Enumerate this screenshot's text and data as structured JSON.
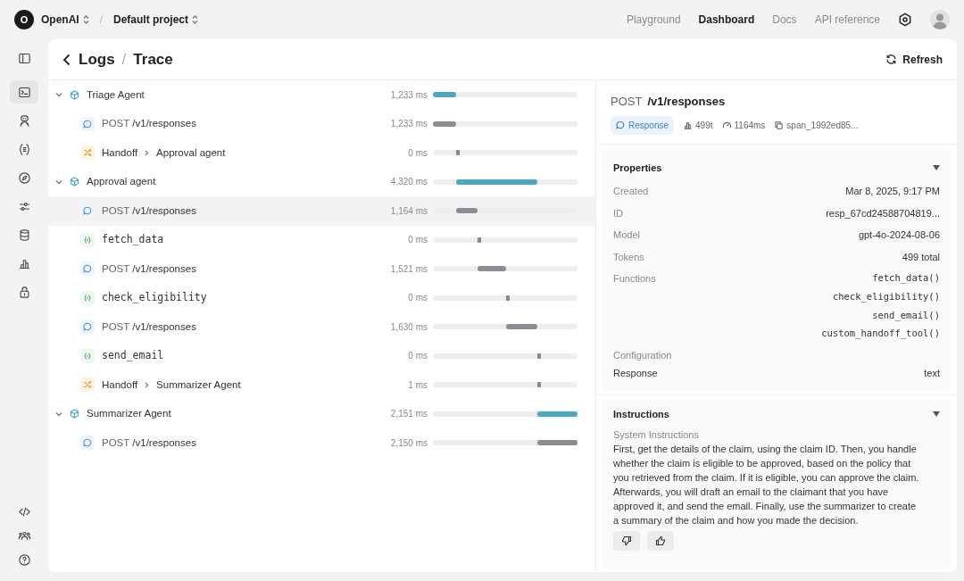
{
  "topbar": {
    "org": "OpenAI",
    "org_initial": "O",
    "project": "Default project",
    "separator": "/",
    "nav": [
      {
        "label": "Playground",
        "selected": false
      },
      {
        "label": "Dashboard",
        "selected": true
      },
      {
        "label": "Docs",
        "selected": false
      },
      {
        "label": "API reference",
        "selected": false
      }
    ]
  },
  "sidebar": {
    "items": [
      {
        "selected": false
      },
      {
        "selected": true
      },
      {
        "selected": false
      },
      {
        "selected": false
      },
      {
        "selected": false
      },
      {
        "selected": false
      },
      {
        "selected": false
      },
      {
        "selected": false
      },
      {
        "selected": false
      }
    ]
  },
  "breadcrumb": {
    "parent": "Logs",
    "separator": "/",
    "current": "Trace"
  },
  "refresh_button": "Refresh",
  "trace": [
    {
      "kind": "agent",
      "label": "Triage Agent",
      "duration": "1,233 ms",
      "expanded": true,
      "selected": false,
      "children": [
        {
          "kind": "response",
          "method": "POST",
          "label": "/v1/responses",
          "duration": "1,233 ms",
          "selected": false
        },
        {
          "kind": "handoff",
          "label": "Handoff",
          "target": "Approval agent",
          "duration": "0 ms",
          "selected": false
        }
      ]
    },
    {
      "kind": "agent",
      "label": "Approval agent",
      "duration": "4,320 ms",
      "expanded": true,
      "selected": false,
      "children": [
        {
          "kind": "response",
          "method": "POST",
          "label": "/v1/responses",
          "duration": "1,164 ms",
          "selected": true
        },
        {
          "kind": "function",
          "label": "fetch_data",
          "duration": "0 ms",
          "selected": false
        },
        {
          "kind": "response",
          "method": "POST",
          "label": "/v1/responses",
          "duration": "1,521 ms",
          "selected": false
        },
        {
          "kind": "function",
          "label": "check_eligibility",
          "duration": "0 ms",
          "selected": false
        },
        {
          "kind": "response",
          "method": "POST",
          "label": "/v1/responses",
          "duration": "1,630 ms",
          "selected": false
        },
        {
          "kind": "function",
          "label": "send_email",
          "duration": "0 ms",
          "selected": false
        },
        {
          "kind": "handoff",
          "label": "Handoff",
          "target": "Summarizer Agent",
          "duration": "1 ms",
          "selected": false
        }
      ]
    },
    {
      "kind": "agent",
      "label": "Summarizer Agent",
      "duration": "2,151 ms",
      "expanded": true,
      "selected": false,
      "children": [
        {
          "kind": "response",
          "method": "POST",
          "label": "/v1/responses",
          "duration": "2,150 ms",
          "selected": false
        }
      ]
    }
  ],
  "detail": {
    "method": "POST",
    "path": "/v1/responses",
    "tag": "Response",
    "meta": [
      "499t",
      "1164ms",
      "span_1992ed85..."
    ],
    "properties": {
      "title": "Properties",
      "expanded": true,
      "rows": [
        {
          "label": "Created",
          "values": [
            "Mar 8, 2025, 9:17 PM"
          ],
          "kind": "text"
        },
        {
          "label": "ID",
          "values": [
            "resp_67cd24588704819..."
          ],
          "kind": "text"
        },
        {
          "label": "Model",
          "values": [
            "gpt-4o-2024-08-06"
          ],
          "kind": "text"
        },
        {
          "label": "Tokens",
          "values": [
            "499 total"
          ],
          "kind": "text"
        },
        {
          "label": "Functions",
          "values": [
            "fetch_data()",
            "check_eligibility()",
            "send_email()",
            "custom_handoff_tool()"
          ],
          "kind": "code"
        }
      ],
      "config_label": "Configuration",
      "config_rows": [
        {
          "label": "Response",
          "value": "text"
        }
      ]
    },
    "instructions": {
      "title": "Instructions",
      "expanded": true,
      "subtitle": "System Instructions",
      "text": "First, get the details of the claim, using the claim ID. Then, you handle whether the claim is eligible to be approved, based on the policy that you retrieved from the claim. If it is eligible, you can approve the claim. Afterwards, you will draft an email to the claimant that you have approved it, and send the email. Finally, use the summarizer to create a summary of the claim and how you made the decision."
    }
  }
}
